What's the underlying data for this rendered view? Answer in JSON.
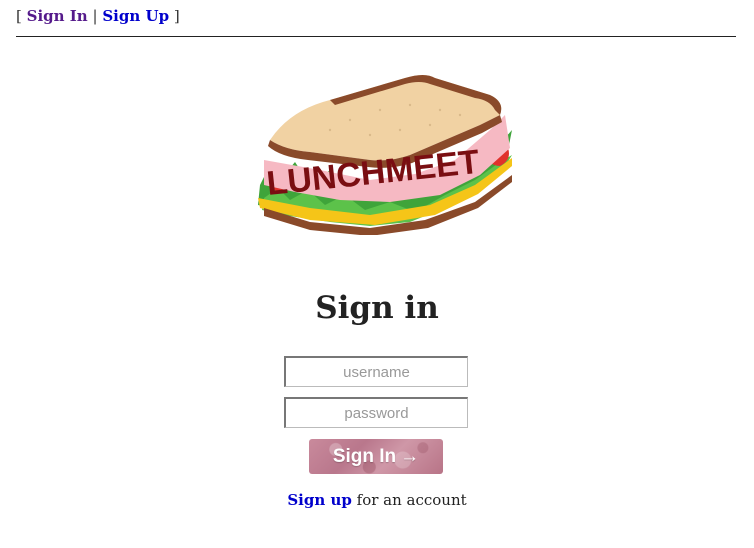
{
  "nav": {
    "open_bracket": "[",
    "sign_in_label": "Sign In",
    "separator": "|",
    "sign_up_label": "Sign Up",
    "close_bracket": "]"
  },
  "logo": {
    "text": "LUNCHMEET",
    "icon": "sandwich-logo-icon"
  },
  "form": {
    "title": "Sign in",
    "username_placeholder": "username",
    "password_placeholder": "password",
    "submit_label": "Sign In",
    "submit_arrow": "→"
  },
  "footer": {
    "signup_link": "Sign up",
    "signup_suffix": " for an account"
  },
  "colors": {
    "link": "#0000cc",
    "visited_link": "#551a8b",
    "button_base": "#c08595",
    "logo_text": "#7a0e12"
  }
}
